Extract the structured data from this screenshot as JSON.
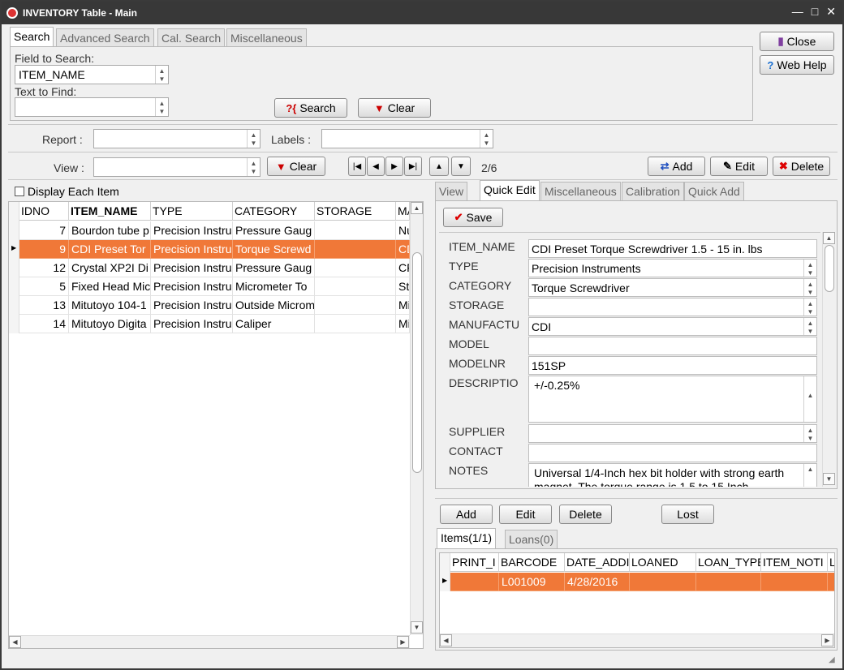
{
  "window": {
    "title": "INVENTORY Table - Main"
  },
  "search_tabs": [
    "Search",
    "Advanced Search",
    "Cal. Search",
    "Miscellaneous"
  ],
  "search": {
    "field_label": "Field to Search:",
    "field_value": "ITEM_NAME",
    "text_label": "Text to Find:",
    "text_value": "",
    "search_btn": "Search",
    "clear_btn": "Clear"
  },
  "top_buttons": {
    "close": "Close",
    "web_help": "Web Help"
  },
  "report_label": "Report :",
  "labels_label": "Labels :",
  "view_label": "View :",
  "view_clear": "Clear",
  "nav": {
    "record": "2/6"
  },
  "actions": {
    "add": "Add",
    "edit": "Edit",
    "delete": "Delete"
  },
  "display_each": "Display Each Item",
  "grid": {
    "columns": [
      "IDNO",
      "ITEM_NAME",
      "TYPE",
      "CATEGORY",
      "STORAGE",
      "MA"
    ],
    "rows": [
      [
        "7",
        "Bourdon tube p",
        "Precision Instru",
        "Pressure Gaug",
        "",
        "Nu"
      ],
      [
        "9",
        "CDI Preset Tor",
        "Precision Instru",
        "Torque Screwd",
        "",
        "CD"
      ],
      [
        "12",
        "Crystal XP2I Di",
        "Precision Instru",
        "Pressure Gaug",
        "",
        "CF"
      ],
      [
        "5",
        "Fixed Head Mic",
        "Precision Instru",
        "Micrometer To",
        "",
        "St"
      ],
      [
        "13",
        "Mitutoyo 104-1",
        "Precision Instru",
        "Outside Microm",
        "",
        "Mi"
      ],
      [
        "14",
        "Mitutoyo Digita",
        "Precision Instru",
        "Caliper",
        "",
        "Mi"
      ]
    ],
    "selected_index": 1
  },
  "detail_tabs": [
    "View",
    "Quick Edit",
    "Miscellaneous",
    "Calibration",
    "Quick Add"
  ],
  "save_btn": "Save",
  "form": {
    "item_name_label": "ITEM_NAME",
    "item_name": "CDI Preset Torque Screwdriver 1.5 - 15 in. lbs",
    "type_label": "TYPE",
    "type": "Precision Instruments",
    "category_label": "CATEGORY",
    "category": "Torque Screwdriver",
    "storage_label": "STORAGE",
    "storage": "",
    "manufactu_label": "MANUFACTU",
    "manufactu": "CDI",
    "model_label": "MODEL",
    "model": "",
    "modelnr_label": "MODELNR",
    "modelnr": "151SP",
    "descriptio_label": "DESCRIPTIO",
    "descriptio": "+/-0.25%",
    "supplier_label": "SUPPLIER",
    "supplier": "",
    "contact_label": "CONTACT",
    "contact": "",
    "notes_label": "NOTES",
    "notes": "Universal 1/4-Inch hex bit holder with strong earth magnet. The torque range is 1.5 to 15 Inch"
  },
  "sub_buttons": {
    "add": "Add",
    "edit": "Edit",
    "delete": "Delete",
    "lost": "Lost"
  },
  "sub_tabs": [
    "Items(1/1)",
    "Loans(0)"
  ],
  "items_grid": {
    "columns": [
      "PRINT_I",
      "BARCODE",
      "DATE_ADDI",
      "LOANED",
      "LOAN_TYPE",
      "ITEM_NOTI",
      "L"
    ],
    "rows": [
      [
        "",
        "L001009",
        "4/28/2016",
        "",
        "",
        "",
        ""
      ]
    ]
  },
  "colors": {
    "selection": "#f07838",
    "titlebar": "#383838"
  }
}
